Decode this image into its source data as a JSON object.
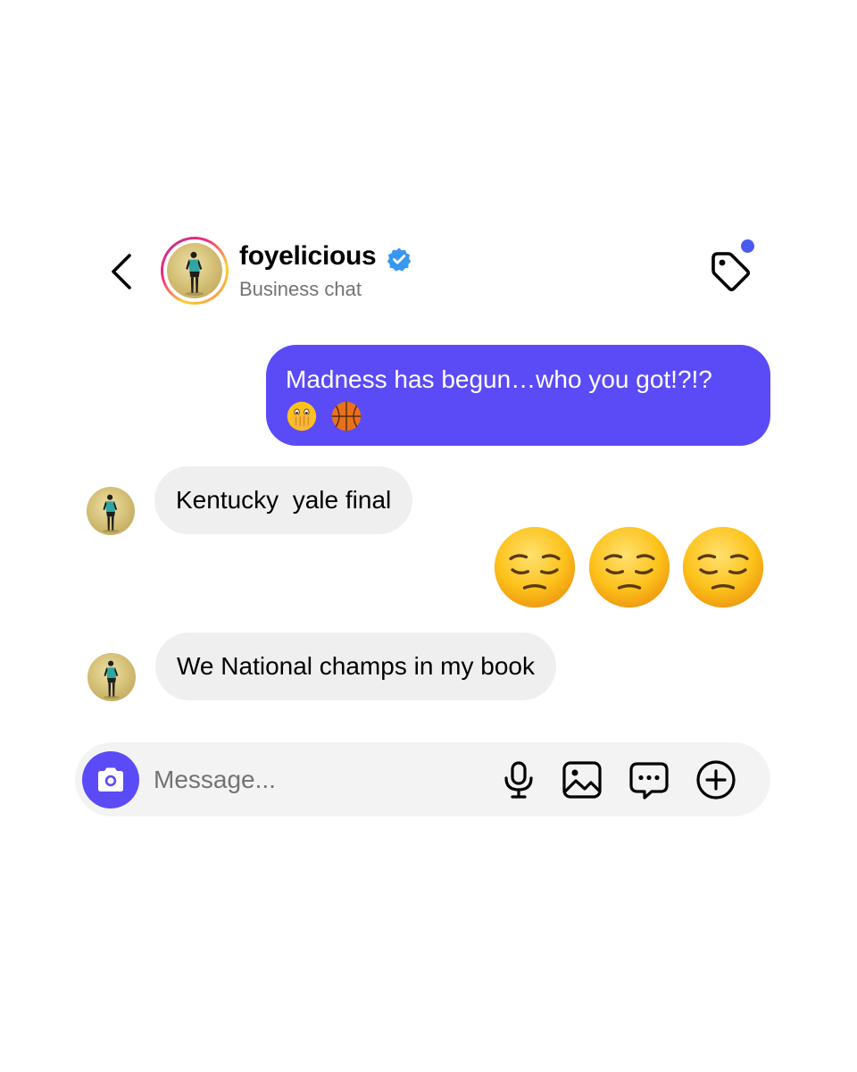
{
  "header": {
    "username": "foyelicious",
    "subtitle": "Business chat",
    "verified": true,
    "back_icon": "chevron-left-icon",
    "tag_icon": "tag-icon",
    "has_notification": true
  },
  "messages": [
    {
      "direction": "outgoing",
      "text": "Madness has begun…who you got!?!?",
      "emojis": [
        "face-with-open-eyes-and-hand-over-mouth",
        "basketball"
      ]
    },
    {
      "direction": "incoming",
      "text": "Kentucky  yale final"
    },
    {
      "direction": "outgoing",
      "emojis": [
        "pensive-face",
        "pensive-face",
        "pensive-face"
      ]
    },
    {
      "direction": "incoming",
      "text": "We National champs in my book"
    }
  ],
  "composer": {
    "placeholder": "Message...",
    "camera_icon": "camera-icon",
    "tools": [
      "microphone-icon",
      "image-icon",
      "chat-bubble-icon",
      "plus-circle-icon"
    ]
  },
  "colors": {
    "accent": "#5b4bf6",
    "incoming_bubble": "#efefef",
    "notification_dot": "#4a5bf0",
    "verified_badge": "#3897f0",
    "secondary_text": "#737373"
  }
}
